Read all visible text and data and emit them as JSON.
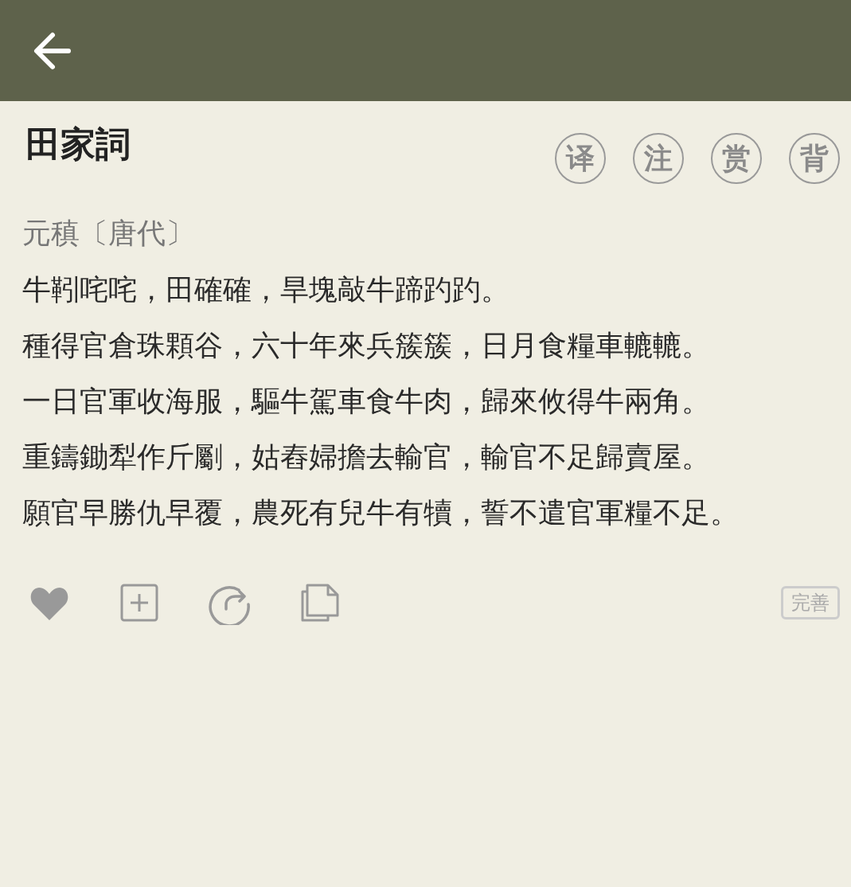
{
  "title": "田家詞",
  "actions": [
    "译",
    "注",
    "赏",
    "背"
  ],
  "author": "元稹〔唐代〕",
  "lines": [
    "牛靷咤咤，田確確，旱塊敲牛蹄趵趵。",
    "種得官倉珠顆谷，六十年來兵簇簇，日月食糧車轆轆。",
    "一日官軍收海服，驅牛駕車食牛肉，歸來攸得牛兩角。",
    "重鑄鋤犁作斤劚，姑舂婦擔去輸官，輸官不足歸賣屋。",
    "願官早勝仇早覆，農死有兒牛有犢，誓不遣官軍糧不足。"
  ],
  "improve_button": "完善"
}
